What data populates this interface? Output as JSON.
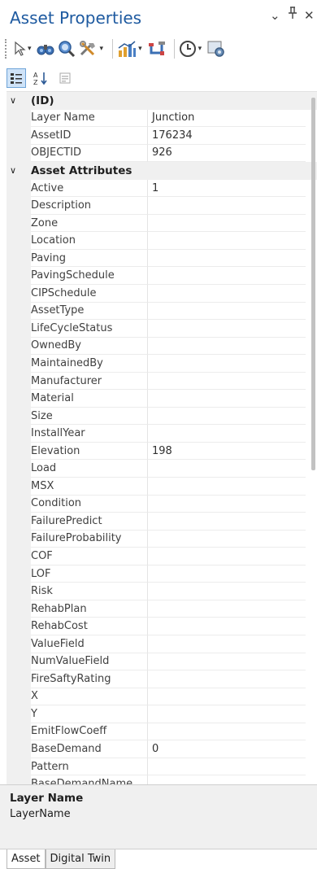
{
  "panel": {
    "title": "Asset Properties",
    "dropdown_glyph": "⌄",
    "pin_glyph": "ᵖ",
    "close_glyph": "✕"
  },
  "toolbar": {
    "icons": [
      "select-arrow-icon",
      "binoculars-icon",
      "zoom-icon",
      "tools-icon",
      "chart-icon",
      "pipe-icon",
      "clock-icon",
      "settings-icon"
    ]
  },
  "view": {
    "categorized_icon": "categorized-icon",
    "alphabetical_icon": "alphabetical-sort-icon",
    "pages_icon": "property-pages-icon"
  },
  "grid": {
    "categories": [
      {
        "label": "(ID)",
        "chevron": "∨",
        "rows": [
          {
            "name": "Layer Name",
            "value": "Junction"
          },
          {
            "name": "AssetID",
            "value": "176234"
          },
          {
            "name": "OBJECTID",
            "value": "926"
          }
        ]
      },
      {
        "label": "Asset Attributes",
        "chevron": "∨",
        "rows": [
          {
            "name": "Active",
            "value": "1"
          },
          {
            "name": "Description",
            "value": ""
          },
          {
            "name": "Zone",
            "value": ""
          },
          {
            "name": "Location",
            "value": ""
          },
          {
            "name": "Paving",
            "value": ""
          },
          {
            "name": "PavingSchedule",
            "value": ""
          },
          {
            "name": "CIPSchedule",
            "value": ""
          },
          {
            "name": "AssetType",
            "value": ""
          },
          {
            "name": "LifeCycleStatus",
            "value": ""
          },
          {
            "name": "OwnedBy",
            "value": ""
          },
          {
            "name": "MaintainedBy",
            "value": ""
          },
          {
            "name": "Manufacturer",
            "value": ""
          },
          {
            "name": "Material",
            "value": ""
          },
          {
            "name": "Size",
            "value": ""
          },
          {
            "name": "InstallYear",
            "value": ""
          },
          {
            "name": "Elevation",
            "value": "198"
          },
          {
            "name": "Load",
            "value": ""
          },
          {
            "name": "MSX",
            "value": ""
          },
          {
            "name": "Condition",
            "value": ""
          },
          {
            "name": "FailurePredict",
            "value": ""
          },
          {
            "name": "FailureProbability",
            "value": ""
          },
          {
            "name": "COF",
            "value": ""
          },
          {
            "name": "LOF",
            "value": ""
          },
          {
            "name": "Risk",
            "value": ""
          },
          {
            "name": "RehabPlan",
            "value": ""
          },
          {
            "name": "RehabCost",
            "value": ""
          },
          {
            "name": "ValueField",
            "value": ""
          },
          {
            "name": "NumValueField",
            "value": ""
          },
          {
            "name": "FireSaftyRating",
            "value": ""
          },
          {
            "name": "X",
            "value": ""
          },
          {
            "name": "Y",
            "value": ""
          },
          {
            "name": "EmitFlowCoeff",
            "value": ""
          },
          {
            "name": "BaseDemand",
            "value": "0"
          },
          {
            "name": "Pattern",
            "value": ""
          },
          {
            "name": "BaseDemandName",
            "value": ""
          }
        ]
      }
    ]
  },
  "description": {
    "title": "Layer Name",
    "text": "LayerName"
  },
  "tabs": [
    {
      "label": "Asset",
      "active": true
    },
    {
      "label": "Digital Twin",
      "active": false
    }
  ]
}
